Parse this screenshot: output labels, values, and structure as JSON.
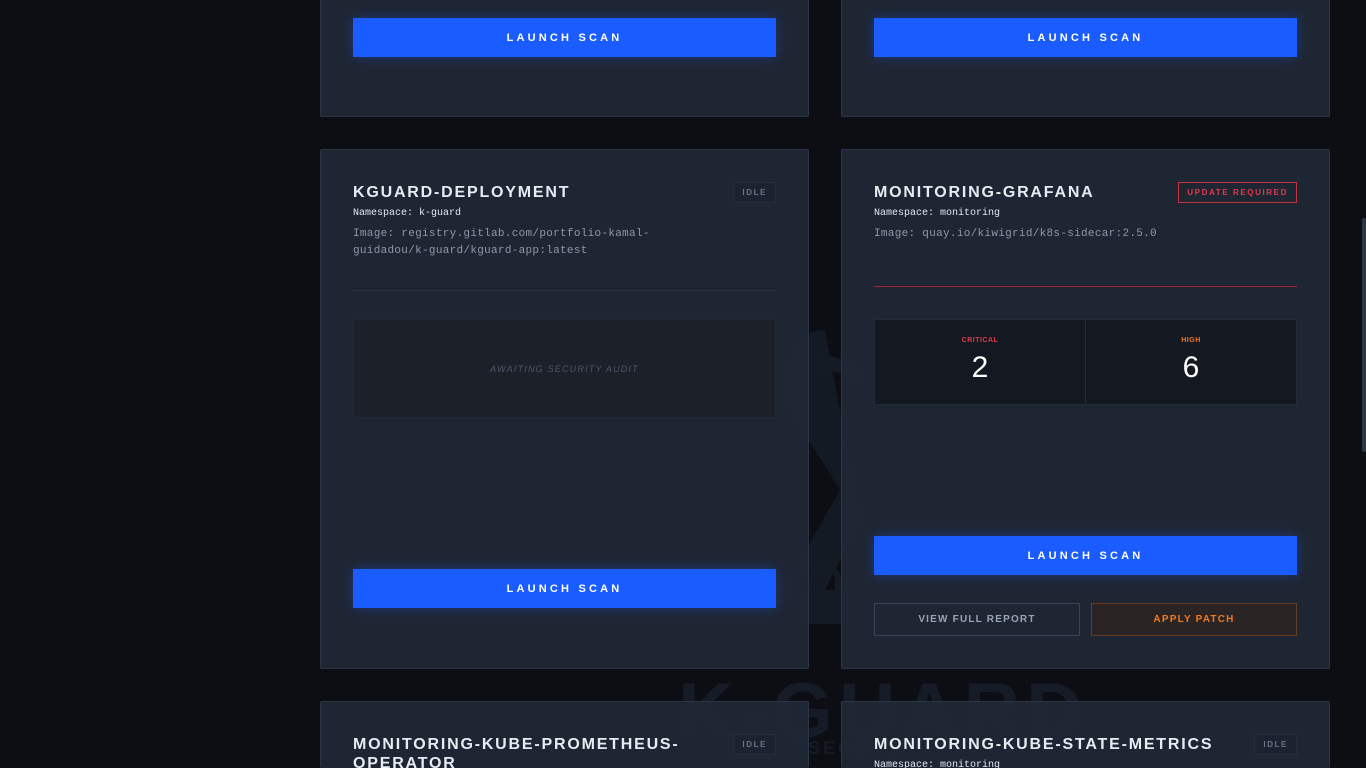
{
  "colors": {
    "accent": "#1a5cff",
    "critical": "#e0394a",
    "high": "#f07a22",
    "background": "#0c0e13",
    "card": "#202835"
  },
  "watermark": {
    "text": "K-GUARD",
    "sub": "SECOPS"
  },
  "cards": {
    "top_left": {
      "launch_label": "LAUNCH SCAN"
    },
    "top_right": {
      "launch_label": "LAUNCH SCAN"
    },
    "kguard": {
      "title": "KGUARD-DEPLOYMENT",
      "badge": "IDLE",
      "namespace": "Namespace: k-guard",
      "image": "Image: registry.gitlab.com/portfolio-kamal-guidadou/k-guard/kguard-app:latest",
      "awaiting": "AWAITING SECURITY AUDIT",
      "launch_label": "LAUNCH SCAN"
    },
    "grafana": {
      "title": "MONITORING-GRAFANA",
      "badge": "UPDATE REQUIRED",
      "namespace": "Namespace: monitoring",
      "image": "Image: quay.io/kiwigrid/k8s-sidecar:2.5.0",
      "critical_label": "CRITICAL",
      "critical_value": "2",
      "high_label": "HIGH",
      "high_value": "6",
      "launch_label": "LAUNCH SCAN",
      "report_label": "VIEW FULL REPORT",
      "patch_label": "APPLY PATCH"
    },
    "prometheus": {
      "title": "MONITORING-KUBE-PROMETHEUS-OPERATOR",
      "badge": "IDLE"
    },
    "state_metrics": {
      "title": "MONITORING-KUBE-STATE-METRICS",
      "badge": "IDLE",
      "namespace": "Namespace: monitoring"
    }
  }
}
